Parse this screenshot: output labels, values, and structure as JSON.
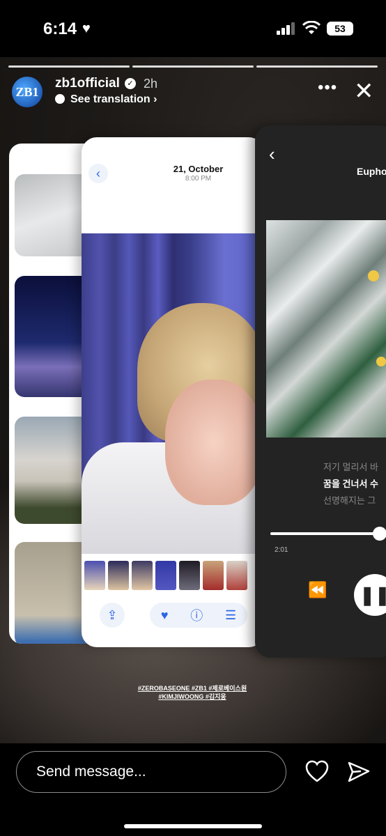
{
  "status_bar": {
    "time": "6:14",
    "battery": "53"
  },
  "story": {
    "username": "zb1official",
    "avatar_text": "ZB1",
    "time_ago": "2h",
    "see_translation": "See translation",
    "more_label": "•••",
    "segments": 3
  },
  "left_card": {
    "thumbnail_count": 4
  },
  "mid_card": {
    "back_icon": "‹",
    "date": "21, October",
    "time": "8:00 PM",
    "share_icon": "share-icon",
    "favorite_icon": "heart-icon",
    "info_icon": "info-icon",
    "adjust_icon": "sliders-icon"
  },
  "right_card": {
    "back_icon": "‹",
    "song_title": "Eupho",
    "lyrics": [
      "저기 멀리서 바",
      "꿈을 건너서 수",
      "선명해지는 그"
    ],
    "position": "2:01",
    "progress": 0.98
  },
  "hashtags": {
    "line1": "#ZEROBASEONE #ZB1 #제로베이스원",
    "line2": "#KIMJIWOONG #김지웅"
  },
  "composer": {
    "placeholder": "Send message..."
  },
  "colors": {
    "accent_blue": "#2b66e6",
    "music_bg": "#232323",
    "flower_yellow": "#f0c845"
  }
}
